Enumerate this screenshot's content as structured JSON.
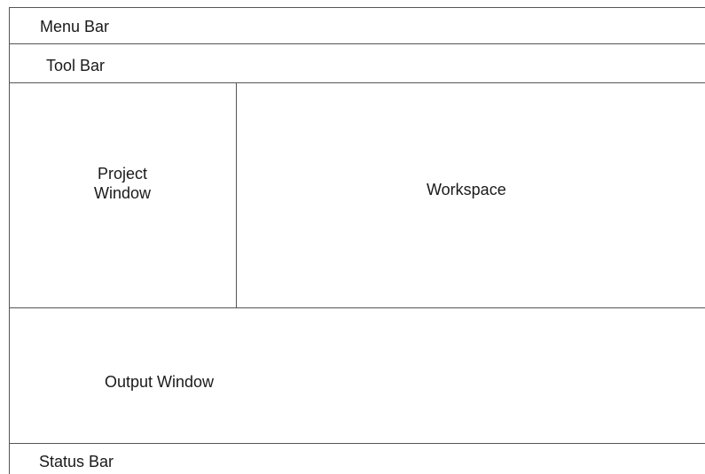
{
  "menu_bar": {
    "label": "Menu Bar"
  },
  "tool_bar": {
    "label": "Tool Bar"
  },
  "project_window": {
    "label_line1": "Project",
    "label_line2": "Window"
  },
  "workspace": {
    "label": "Workspace"
  },
  "output_window": {
    "label": "Output Window"
  },
  "status_bar": {
    "label": "Status Bar"
  }
}
